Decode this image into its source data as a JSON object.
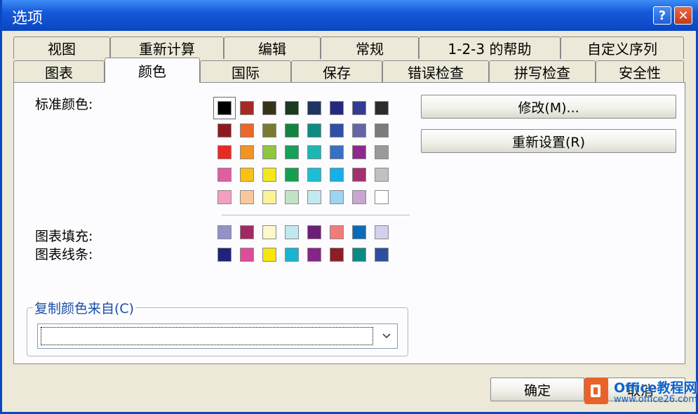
{
  "window": {
    "title": "选项",
    "help": "?",
    "close": "✕"
  },
  "tabs_back": [
    {
      "label": "视图",
      "name": "tab-view"
    },
    {
      "label": "重新计算",
      "name": "tab-recalc"
    },
    {
      "label": "编辑",
      "name": "tab-edit"
    },
    {
      "label": "常规",
      "name": "tab-general"
    },
    {
      "label": "1-2-3 的帮助",
      "name": "tab-lotus-help"
    },
    {
      "label": "自定义序列",
      "name": "tab-custom-lists"
    }
  ],
  "tabs_front": [
    {
      "label": "图表",
      "name": "tab-chart"
    },
    {
      "label": "颜色",
      "name": "tab-color",
      "active": true
    },
    {
      "label": "国际",
      "name": "tab-international"
    },
    {
      "label": "保存",
      "name": "tab-save"
    },
    {
      "label": "错误检查",
      "name": "tab-error-checking"
    },
    {
      "label": "拼写检查",
      "name": "tab-spelling"
    },
    {
      "label": "安全性",
      "name": "tab-security"
    }
  ],
  "labels": {
    "standard_colors": "标准颜色:",
    "chart_fill": "图表填充:",
    "chart_lines": "图表线条:"
  },
  "standard_colors": [
    [
      "#000000",
      "#a52a23",
      "#35331a",
      "#1a3a20",
      "#1d3562",
      "#262a7e",
      "#343994",
      "#2b2b2b"
    ],
    [
      "#8e1a20",
      "#e9682a",
      "#797a2f",
      "#118442",
      "#0f8a83",
      "#2f4fa6",
      "#6566a3",
      "#7b7b7b"
    ],
    [
      "#e82a25",
      "#f29425",
      "#8ec73d",
      "#16a05a",
      "#1fb5b5",
      "#3a6fc3",
      "#8b2a8c",
      "#9a9a9a"
    ],
    [
      "#de5fa3",
      "#fbc016",
      "#f4e81a",
      "#12a04e",
      "#1ebdd4",
      "#16b0e8",
      "#a4306e",
      "#c1c1c1"
    ],
    [
      "#f29fc2",
      "#f9c89a",
      "#fbf396",
      "#c2e3c4",
      "#c4e8ef",
      "#9ed3f1",
      "#c8a6d1",
      "#ffffff"
    ]
  ],
  "chart_fill_colors": [
    "#9292c8",
    "#a02a64",
    "#fdf8cb",
    "#c2e8ef",
    "#6b2076",
    "#f07c7a",
    "#0a6cb8",
    "#d1d0ee"
  ],
  "chart_line_colors": [
    "#1f237a",
    "#de4d99",
    "#f6e60e",
    "#18b5d2",
    "#852588",
    "#8b1f24",
    "#0a8a86",
    "#2d4ea0"
  ],
  "buttons": {
    "modify": "修改(M)...",
    "reset": "重新设置(R)",
    "ok": "确定",
    "cancel": "取消"
  },
  "copy_colors": {
    "legend": "复制颜色来自(C)",
    "value": ""
  },
  "watermark": {
    "title": "Office教程网",
    "url": "www.office26.com"
  }
}
